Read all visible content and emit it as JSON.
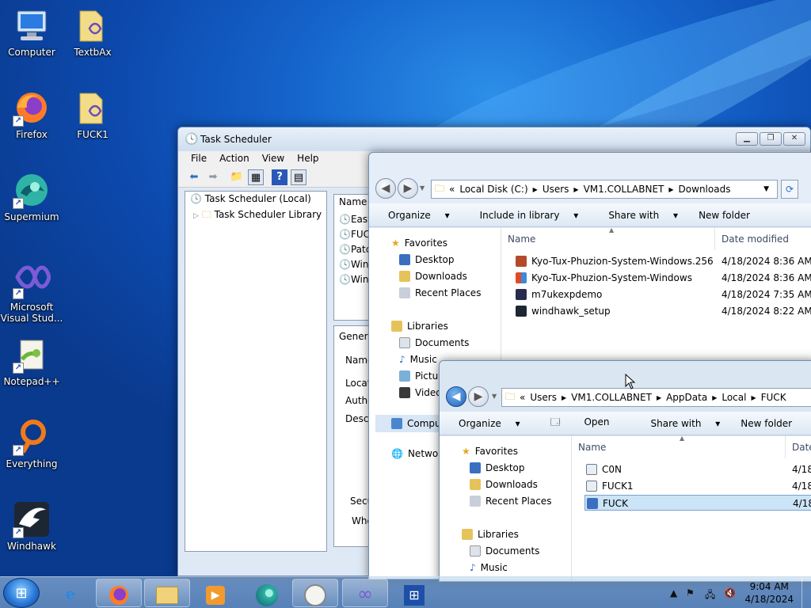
{
  "desktop": {
    "icons": [
      {
        "label": "Computer",
        "icon": "computer-icon"
      },
      {
        "label": "TextbAx",
        "icon": "folder-icon"
      },
      {
        "label": "Firefox",
        "icon": "firefox-icon"
      },
      {
        "label": "FUCK1",
        "icon": "folder-icon"
      },
      {
        "label": "Supermium",
        "icon": "supermium-icon"
      },
      {
        "label": "Microsoft Visual Stud...",
        "icon": "visual-studio-icon"
      },
      {
        "label": "Notepad++",
        "icon": "notepadpp-icon"
      },
      {
        "label": "Everything",
        "icon": "everything-icon"
      },
      {
        "label": "Windhawk",
        "icon": "windhawk-icon"
      }
    ]
  },
  "task_scheduler": {
    "title": "Task Scheduler",
    "menu": [
      "File",
      "Action",
      "View",
      "Help"
    ],
    "tree": {
      "root": "Task Scheduler (Local)",
      "library": "Task Scheduler Library"
    },
    "list_header": "Name",
    "list_items": [
      "Easy",
      "FUC",
      "Patc",
      "Win",
      "Win"
    ],
    "detail_tab": "Genera",
    "detail_labels": [
      "Name",
      "Locat",
      "Autho",
      "Descr",
      "Secu",
      "Whe"
    ]
  },
  "explorer_downloads": {
    "breadcrumb": [
      "«",
      "Local Disk (C:)",
      "Users",
      "VM1.COLLABNET",
      "Downloads"
    ],
    "commands": [
      "Organize",
      "Include in library",
      "Share with",
      "New folder"
    ],
    "nav": {
      "favorites": "Favorites",
      "fav_items": [
        "Desktop",
        "Downloads",
        "Recent Places"
      ],
      "libraries": "Libraries",
      "lib_items": [
        "Documents",
        "Music",
        "Pictur",
        "Video"
      ],
      "computer": "Compu",
      "network": "Networ"
    },
    "columns": [
      "Name",
      "Date modified"
    ],
    "files": [
      {
        "name": "Kyo-Tux-Phuzion-System-Windows.256",
        "date": "4/18/2024 8:36 AM"
      },
      {
        "name": "Kyo-Tux-Phuzion-System-Windows",
        "date": "4/18/2024 8:36 AM"
      },
      {
        "name": "m7ukexpdemo",
        "date": "4/18/2024 7:35 AM"
      },
      {
        "name": "windhawk_setup",
        "date": "4/18/2024 8:22 AM"
      }
    ]
  },
  "explorer_fuck": {
    "breadcrumb": [
      "«",
      "Users",
      "VM1.COLLABNET",
      "AppData",
      "Local",
      "FUCK"
    ],
    "commands": [
      "Organize",
      "Open",
      "Share with",
      "New folder"
    ],
    "nav": {
      "favorites": "Favorites",
      "fav_items": [
        "Desktop",
        "Downloads",
        "Recent Places"
      ],
      "libraries": "Libraries",
      "lib_items": [
        "Documents",
        "Music"
      ]
    },
    "columns": [
      "Name",
      "Date"
    ],
    "files": [
      {
        "name": "C0N",
        "date": "4/18"
      },
      {
        "name": "FUCK1",
        "date": "4/18"
      },
      {
        "name": "FUCK",
        "date": "4/18"
      }
    ]
  },
  "taskbar": {
    "time": "9:04 AM",
    "date": "4/18/2024"
  },
  "colors": {
    "selection": "#cce4f7",
    "accent": "#1565cc"
  }
}
